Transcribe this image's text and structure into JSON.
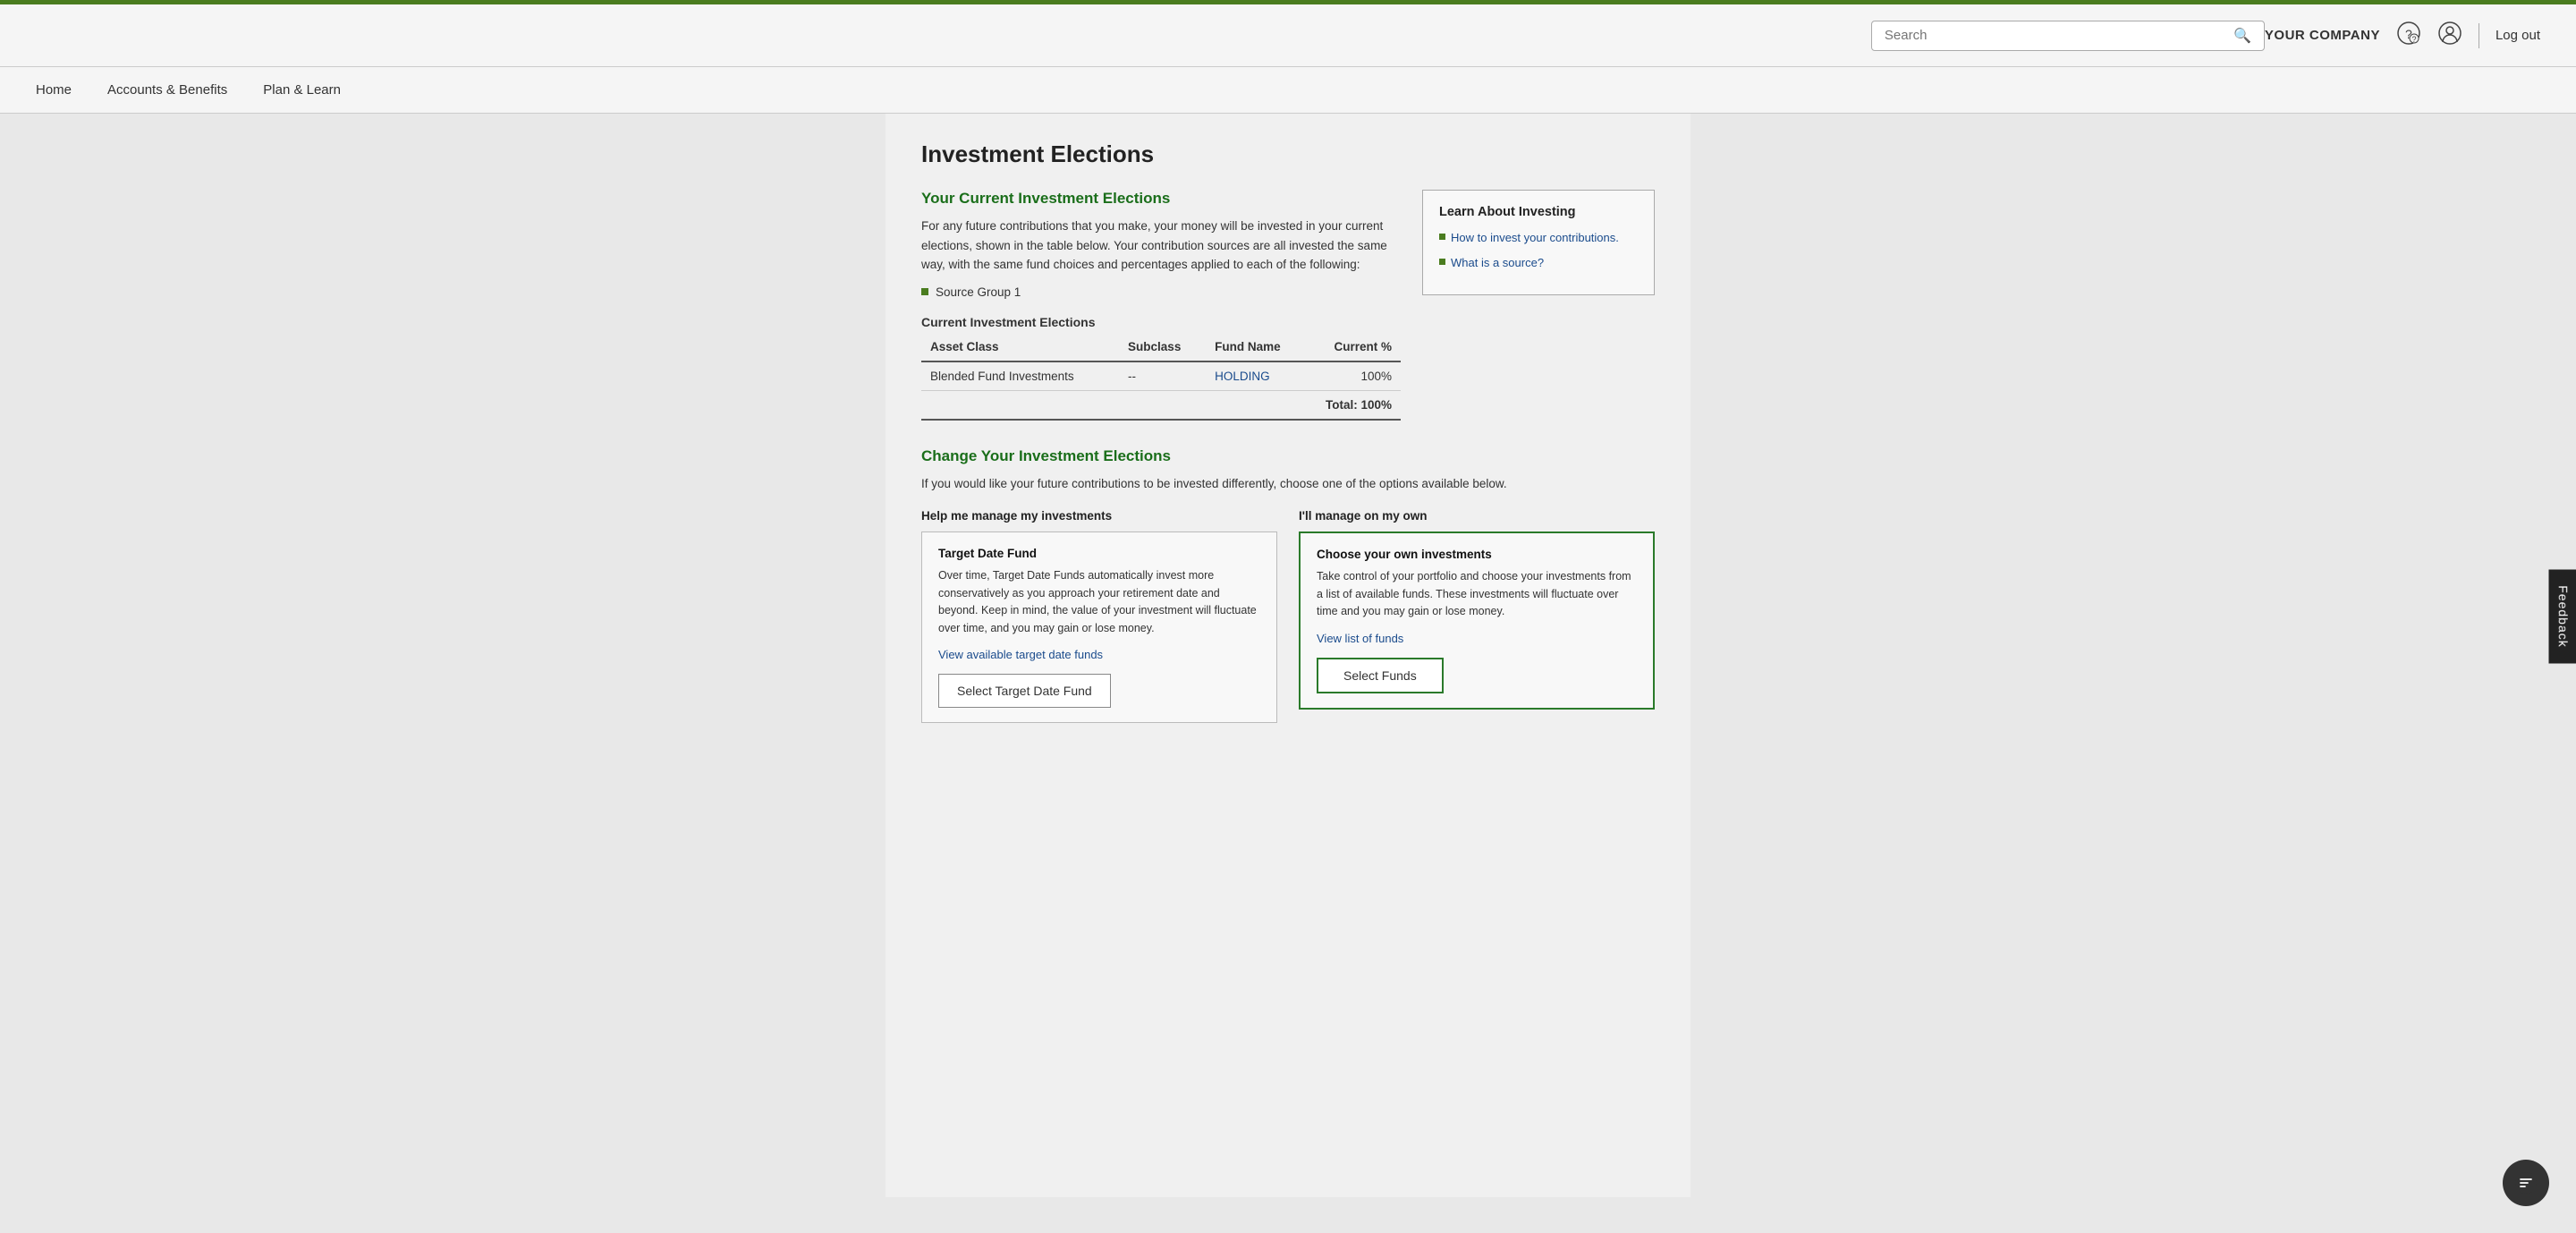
{
  "accent_color": "#4a7c1f",
  "header": {
    "search_placeholder": "Search",
    "search_icon": "🔍",
    "company_name": "YOUR COMPANY",
    "help_icon": "💬",
    "user_icon": "👤",
    "logout_label": "Log out"
  },
  "nav": {
    "items": [
      {
        "label": "Home",
        "id": "home"
      },
      {
        "label": "Accounts & Benefits",
        "id": "accounts"
      },
      {
        "label": "Plan & Learn",
        "id": "plan"
      }
    ]
  },
  "page": {
    "title": "Investment Elections",
    "current_section": {
      "heading": "Your Current Investment Elections",
      "description": "For any future contributions that you make, your money will be invested in your current elections, shown in the table below. Your contribution sources are all invested the same way, with the same fund choices and percentages applied to each of the following:",
      "source_group_label": "Source Group 1",
      "table_title": "Current Investment Elections",
      "table_headers": [
        "Asset Class",
        "Subclass",
        "Fund Name",
        "Current %"
      ],
      "table_rows": [
        {
          "asset_class": "Blended Fund Investments",
          "subclass": "--",
          "fund_name": "HOLDING",
          "current_pct": "100%"
        }
      ],
      "total_label": "Total: 100%"
    },
    "sidebar": {
      "title": "Learn About Investing",
      "links": [
        {
          "text": "How to invest your contributions."
        },
        {
          "text": "What is a source?"
        }
      ]
    },
    "change_section": {
      "heading": "Change Your Investment Elections",
      "description": "If you would like your future contributions to be invested differently, choose one of the options available below.",
      "col_left_label": "Help me manage my investments",
      "col_right_label": "I'll manage on my own",
      "target_date_card": {
        "heading": "Target Date Fund",
        "description": "Over time, Target Date Funds automatically invest more conservatively as you approach your retirement date and beyond. Keep in mind, the value of your investment will fluctuate over time, and you may gain or lose money.",
        "link_text": "View available target date funds",
        "button_label": "Select Target Date Fund"
      },
      "own_investments_card": {
        "heading": "Choose your own investments",
        "description": "Take control of your portfolio and choose your investments from a list of available funds. These investments will fluctuate over time and you may gain or lose money.",
        "link_text": "View list of funds",
        "button_label": "Select Funds"
      }
    },
    "feedback_label": "Feedback",
    "chat_icon": "💬"
  }
}
